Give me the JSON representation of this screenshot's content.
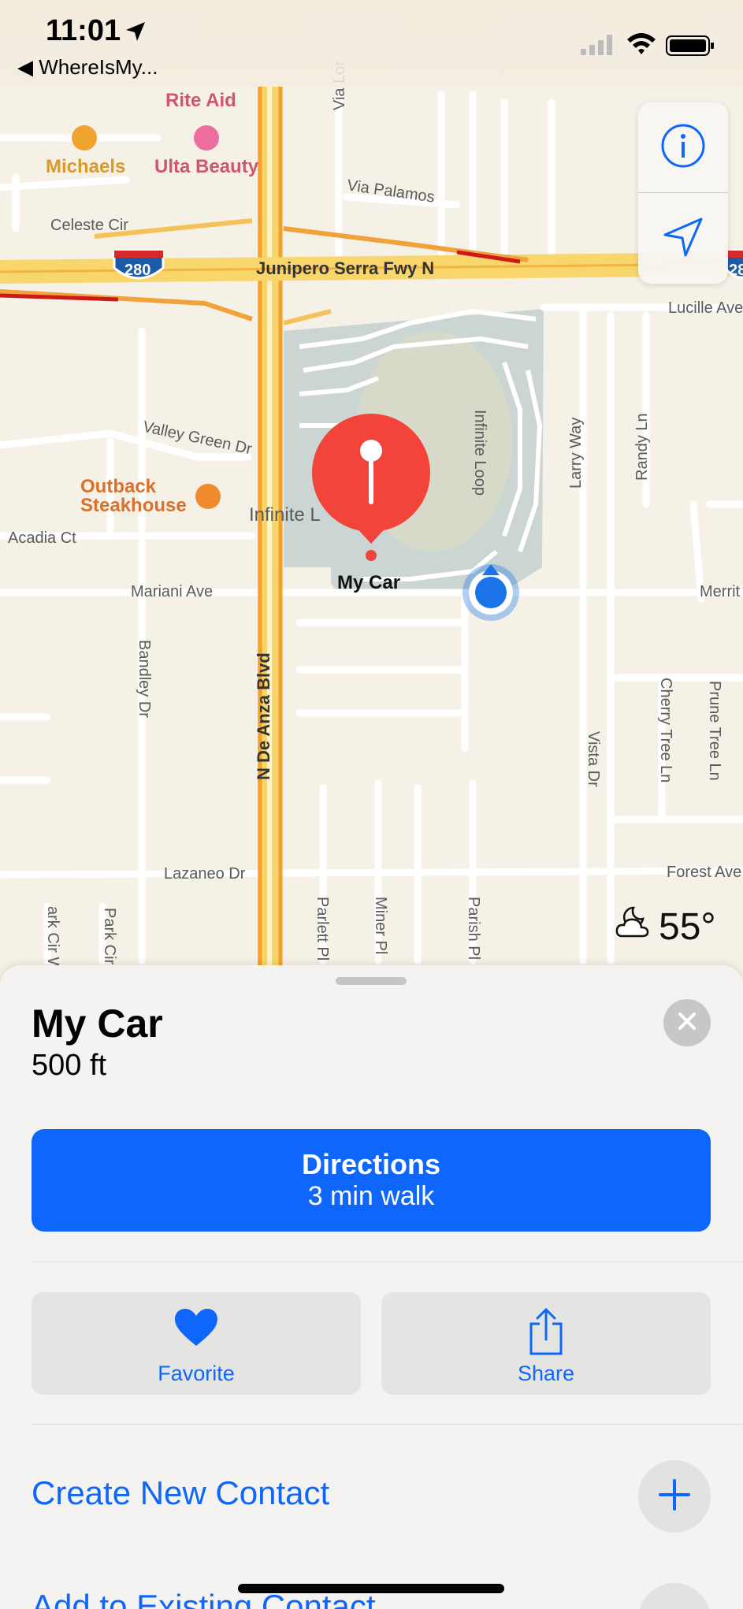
{
  "status_bar": {
    "time": "11:01",
    "back_label": "◀ WhereIsMy..."
  },
  "map": {
    "street_labels": {
      "rite_aid": "Rite Aid",
      "michaels": "Michaels",
      "ulta": "Ulta Beauty",
      "via_lor": "Via Lor",
      "via_palamos": "Via Palamos",
      "celeste": "Celeste Cir",
      "interstate": "280",
      "interstate_right": "28",
      "junipero": "Junipero Serra Fwy N",
      "lucille": "Lucille Ave",
      "valley_green": "Valley Green Dr",
      "outback": "Outback\nSteakhouse",
      "infinite_loop_left": "Infinite L",
      "infinite_loop": "Infinite Loop",
      "larry_way": "Larry Way",
      "randy_ln": "Randy Ln",
      "acadia": "Acadia Ct",
      "mariani": "Mariani Ave",
      "merrit": "Merrit",
      "bandley": "Bandley Dr",
      "de_anza": "N De Anza Blvd",
      "cherry_tree": "Cherry Tree Ln",
      "prune_tree": "Prune Tree Ln",
      "vista": "Vista Dr",
      "lazaneo": "Lazaneo Dr",
      "forest": "Forest Ave",
      "parlett": "Parlett Pl",
      "miner": "Miner Pl",
      "parish": "Parish Pl",
      "park_cir_w": "ark Cir W",
      "park_cir": "Park Cir",
      "car_pin_label": "My Car"
    },
    "weather": {
      "icon": "partly-cloudy-night-icon",
      "temperature": "55°"
    }
  },
  "sheet": {
    "title": "My Car",
    "distance": "500 ft",
    "directions_label": "Directions",
    "directions_sub": "3 min walk",
    "favorite_label": "Favorite",
    "share_label": "Share",
    "create_contact_label": "Create New Contact",
    "existing_contact_label": "Add to Existing Contact"
  },
  "colors": {
    "accent": "#0e66fb",
    "pin": "#f2443a",
    "location": "#1a73e8"
  }
}
